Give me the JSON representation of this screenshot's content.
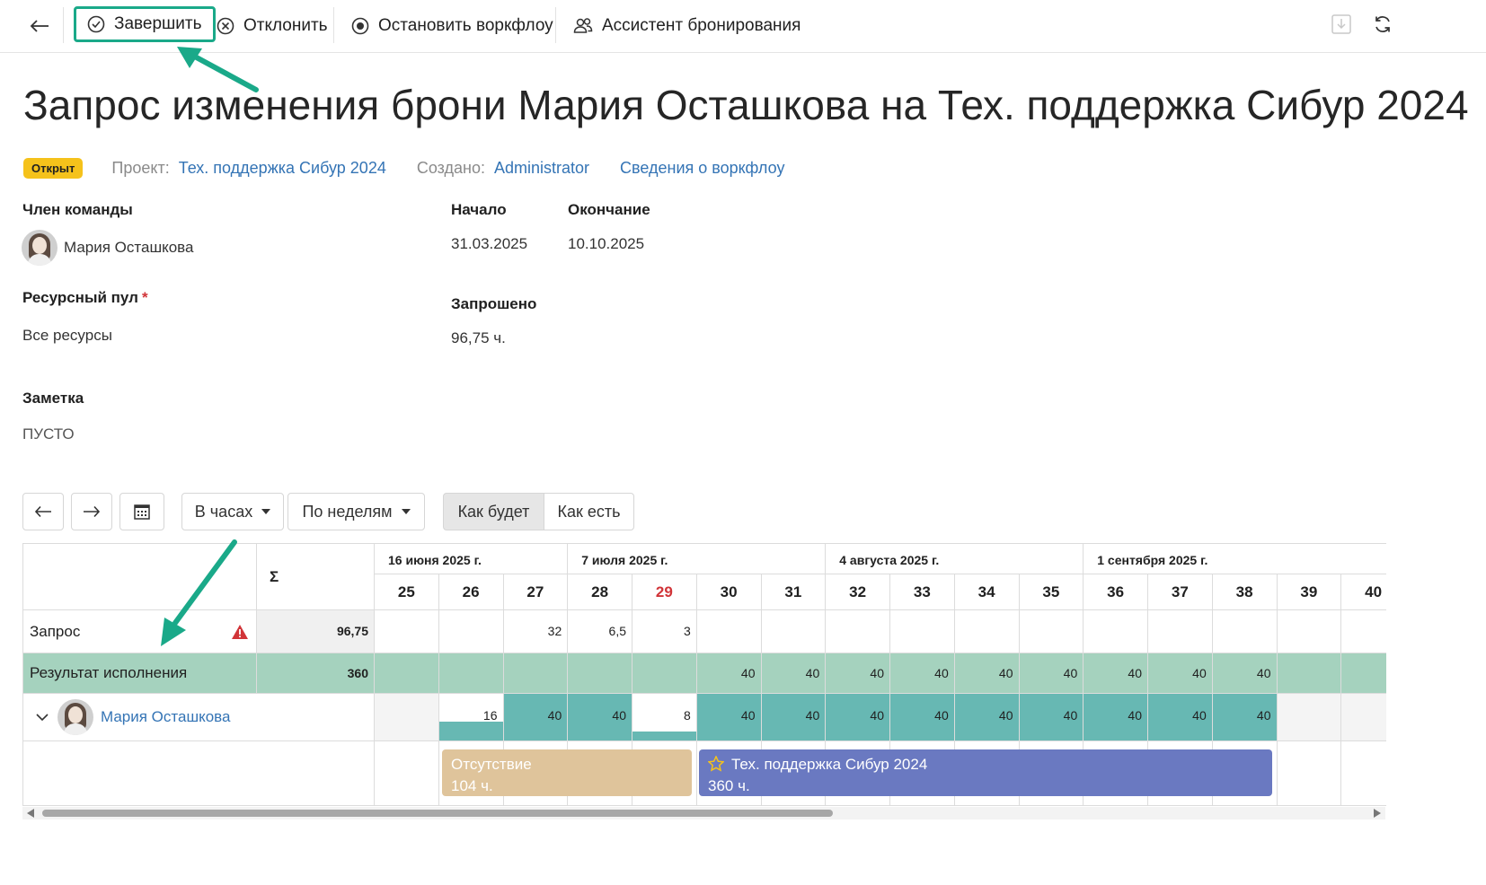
{
  "toolbar": {
    "finish_label": "Завершить",
    "reject_label": "Отклонить",
    "stop_label": "Остановить воркфлоу",
    "assistant_label": "Ассистент бронирования"
  },
  "page": {
    "title": "Запрос изменения брони Мария Осташкова на Тех. поддержка Сибур 2024",
    "status": "Открыт",
    "project_label": "Проект:",
    "project_value": "Тех. поддержка Сибур 2024",
    "created_label": "Создано:",
    "created_value": "Administrator",
    "workflow_link": "Сведения о воркфлоу"
  },
  "fields": {
    "member_label": "Член команды",
    "member_value": "Мария Осташкова",
    "start_label": "Начало",
    "start_value": "31.03.2025",
    "end_label": "Окончание",
    "end_value": "10.10.2025",
    "pool_label": "Ресурсный пул",
    "pool_value": "Все ресурсы",
    "requested_label": "Запрошено",
    "requested_value": "96,75 ч.",
    "note_label": "Заметка",
    "note_value": "ПУСТО"
  },
  "controls": {
    "units": "В часах",
    "period": "По неделям",
    "mode_planned": "Как будет",
    "mode_actual": "Как есть"
  },
  "grid": {
    "sigma": "Σ",
    "months": [
      "16 июня 2025 г.",
      "7 июля 2025 г.",
      "4 августа 2025 г.",
      "1 сентября 2025 г."
    ],
    "weeks": [
      "25",
      "26",
      "27",
      "28",
      "29",
      "30",
      "31",
      "32",
      "33",
      "34",
      "35",
      "36",
      "37",
      "38",
      "39",
      "40"
    ],
    "highlight_week": "29",
    "rows": {
      "request": {
        "label": "Запрос",
        "total": "96,75",
        "values": [
          "",
          "",
          "32",
          "6,5",
          "3",
          "",
          "",
          "",
          "",
          "",
          "",
          "",
          "",
          "",
          "",
          ""
        ]
      },
      "result": {
        "label": "Результат исполнения",
        "total": "360",
        "values": [
          "",
          "",
          "",
          "",
          "",
          "40",
          "40",
          "40",
          "40",
          "40",
          "40",
          "40",
          "40",
          "40",
          "",
          ""
        ]
      },
      "member": {
        "name": "Мария Осташкова",
        "values": [
          "",
          "16",
          "40",
          "40",
          "8",
          "40",
          "40",
          "40",
          "40",
          "40",
          "40",
          "40",
          "40",
          "40",
          "",
          ""
        ],
        "fill": [
          0,
          0.4,
          1,
          1,
          0.2,
          1,
          1,
          1,
          1,
          1,
          1,
          1,
          1,
          1,
          0,
          0
        ]
      }
    },
    "bookings": [
      {
        "title": "Отсутствие",
        "hours": "104 ч.",
        "color": "#dfc49b"
      },
      {
        "title": "Тех. поддержка Сибур 2024",
        "hours": "360 ч.",
        "color": "#6a79c1"
      }
    ]
  },
  "colors": {
    "accent": "#1aa989",
    "link": "#3474b5",
    "status_badge": "#f5c21b",
    "result_row": "#a5d2be",
    "member_fill": "#67b8b3",
    "warning": "#d13438"
  }
}
